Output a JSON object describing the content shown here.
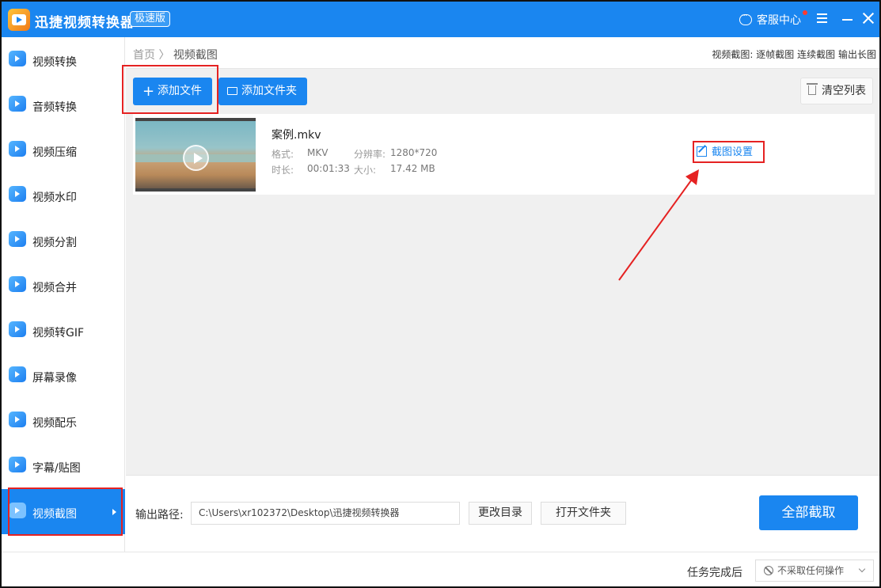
{
  "titlebar": {
    "app_title": "迅捷视频转换器",
    "edition": "极速版",
    "service": "客服中心"
  },
  "sidebar": {
    "items": [
      {
        "label": "视频转换",
        "icon": "video-convert-icon"
      },
      {
        "label": "音频转换",
        "icon": "audio-convert-icon"
      },
      {
        "label": "视频压缩",
        "icon": "video-compress-icon"
      },
      {
        "label": "视频水印",
        "icon": "video-watermark-icon"
      },
      {
        "label": "视频分割",
        "icon": "video-split-icon"
      },
      {
        "label": "视频合并",
        "icon": "video-merge-icon"
      },
      {
        "label": "视频转GIF",
        "icon": "video-gif-icon"
      },
      {
        "label": "屏幕录像",
        "icon": "screen-record-icon"
      },
      {
        "label": "视频配乐",
        "icon": "video-music-icon"
      },
      {
        "label": "字幕/贴图",
        "icon": "subtitle-sticker-icon"
      },
      {
        "label": "视频截图",
        "icon": "video-screenshot-icon"
      }
    ],
    "active_index": 10
  },
  "breadcrumb": {
    "home": "首页",
    "separator": "〉",
    "current": "视频截图"
  },
  "modes": {
    "prefix": "视频截图:",
    "items": [
      "逐帧截图",
      "连续截图",
      "输出长图"
    ]
  },
  "toolbar": {
    "add_file": "添加文件",
    "add_folder": "添加文件夹",
    "clear_list": "清空列表"
  },
  "file": {
    "name": "案例.mkv",
    "format_label": "格式:",
    "format": "MKV",
    "resolution_label": "分辨率:",
    "resolution": "1280*720",
    "duration_label": "时长:",
    "duration": "00:01:33",
    "size_label": "大小:",
    "size": "17.42 MB",
    "crop_setting": "截图设置"
  },
  "output": {
    "label": "输出路径:",
    "path": "C:\\Users\\xr102372\\Desktop\\迅捷视频转换器",
    "change_dir": "更改目录",
    "open_folder": "打开文件夹",
    "extract_all": "全部截取"
  },
  "status": {
    "task_label": "任务完成后",
    "task_option": "不采取任何操作"
  },
  "colors": {
    "accent": "#1a86f0",
    "annotation": "#e52222"
  }
}
